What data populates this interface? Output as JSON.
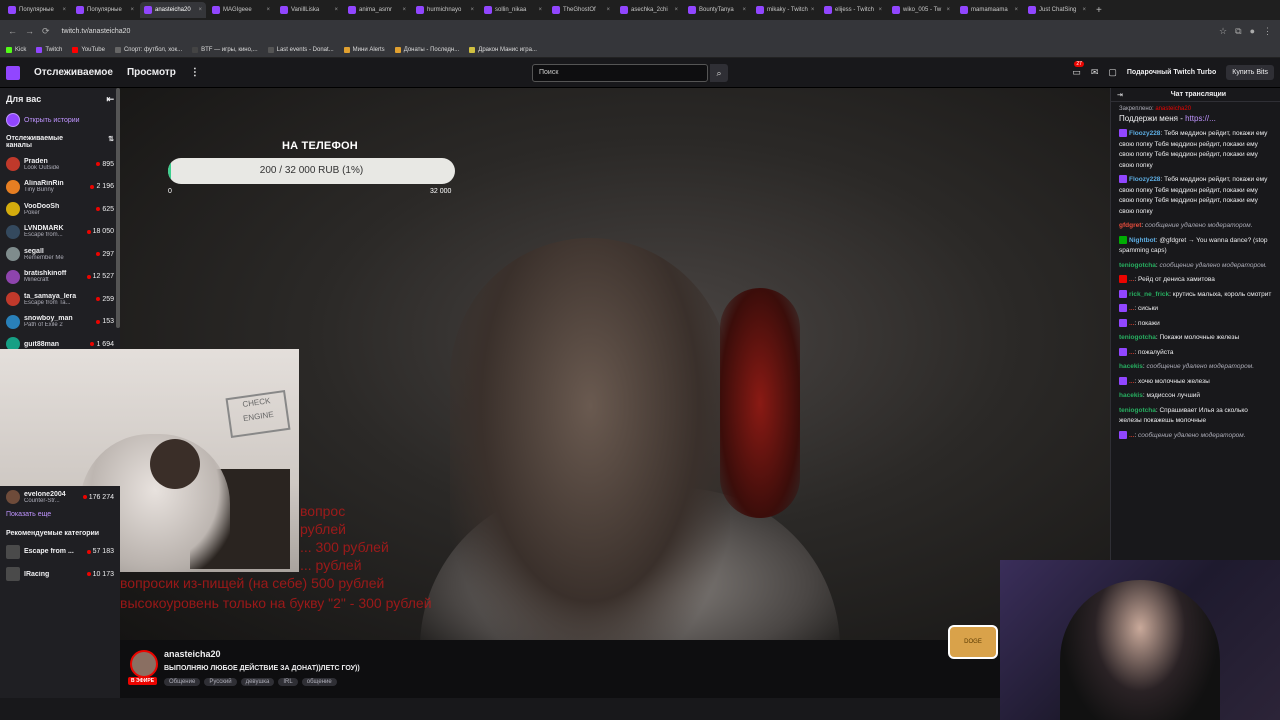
{
  "browser": {
    "tabs": [
      {
        "label": "Популярные",
        "active": false
      },
      {
        "label": "Популярные",
        "active": false
      },
      {
        "label": "anasteicha20",
        "active": true
      },
      {
        "label": "MAGIgeee",
        "active": false
      },
      {
        "label": "VanillLiska",
        "active": false
      },
      {
        "label": "anima_asmr",
        "active": false
      },
      {
        "label": "hurmichnayo",
        "active": false
      },
      {
        "label": "sollin_nikaa",
        "active": false
      },
      {
        "label": "TheGhostOf",
        "active": false
      },
      {
        "label": "asechka_2chi",
        "active": false
      },
      {
        "label": "BountyTanya",
        "active": false
      },
      {
        "label": "mikaky - Twitch",
        "active": false
      },
      {
        "label": "elijess - Twitch",
        "active": false
      },
      {
        "label": "wiko_005 - Tw",
        "active": false
      },
      {
        "label": "mamamaama",
        "active": false
      },
      {
        "label": "Just ChatSing",
        "active": false
      }
    ],
    "url": "twitch.tv/anasteicha20",
    "bookmarks": [
      {
        "label": "Kick",
        "color": "#53fc18"
      },
      {
        "label": "Twitch",
        "color": "#9146ff"
      },
      {
        "label": "YouTube",
        "color": "#ff0000"
      },
      {
        "label": "Спорт: футбол, хок...",
        "color": "#666666"
      },
      {
        "label": "BTF — игры, кино,...",
        "color": "#444444"
      },
      {
        "label": "Last events - Donat...",
        "color": "#555555"
      },
      {
        "label": "Мини Alerts",
        "color": "#e0a030"
      },
      {
        "label": "Донаты - Последн...",
        "color": "#e0a030"
      },
      {
        "label": "Дракон Манис игра...",
        "color": "#d0c040"
      }
    ]
  },
  "topnav": {
    "following": "Отслеживаемое",
    "browse": "Просмотр",
    "search_placeholder": "Поиск",
    "notif_count": "27",
    "turbo": "Подарочный Twitch Turbo",
    "bits": "Купить Bits"
  },
  "sidebar": {
    "title": "Для вас",
    "stories": "Открыть истории",
    "followed_title": "Отслеживаемые каналы",
    "channels": [
      {
        "name": "Praden",
        "game": "Look Outside",
        "viewers": "895",
        "color": "#c0392b"
      },
      {
        "name": "AlinaRinRin",
        "game": "Tiny Bunny",
        "viewers": "2 196",
        "color": "#e67e22"
      },
      {
        "name": "VooDooSh",
        "game": "Poker",
        "viewers": "625",
        "color": "#d4ac0d"
      },
      {
        "name": "LVNDMARK",
        "game": "Escape from...",
        "viewers": "18 050",
        "color": "#34495e"
      },
      {
        "name": "segall",
        "game": "Remember Me",
        "viewers": "297",
        "color": "#7f8c8d"
      },
      {
        "name": "bratishkinoff",
        "game": "Minecraft",
        "viewers": "12 527",
        "color": "#8e44ad"
      },
      {
        "name": "ta_samaya_lera",
        "game": "Escape from Ta...",
        "viewers": "259",
        "color": "#c0392b"
      },
      {
        "name": "snowboy_man",
        "game": "Path of Exile 2",
        "viewers": "153",
        "color": "#2980b9"
      },
      {
        "name": "guit88man",
        "game": "",
        "viewers": "1 694",
        "color": "#16a085"
      }
    ],
    "lower_channel": {
      "name": "evelone2004",
      "game": "Counter-Str...",
      "viewers": "176 274"
    },
    "show_more": "Показать еще",
    "recommended_title": "Рекомендуемые категории",
    "categories": [
      {
        "name": "Escape from ...",
        "viewers": "57 183"
      },
      {
        "name": "IRacing",
        "viewers": "10 173"
      }
    ]
  },
  "goal": {
    "title": "НА ТЕЛЕФОН",
    "label": "200 / 32 000 RUB (1%)",
    "progress": 0.01,
    "min": "0",
    "max": "32 000"
  },
  "overlay": {
    "lines": [
      {
        "text": "вопрос",
        "top": 0
      },
      {
        "text": "рублей",
        "top": 0
      },
      {
        "text": "... 300 рублей",
        "top": 0
      },
      {
        "text": "... рублей",
        "top": 0
      },
      {
        "text": "вопросик из-пищей (на себе) 500 рублей",
        "top": 0
      },
      {
        "text": "высокоуровень только на букву \"2\" - 300 рублей",
        "top": 0
      }
    ]
  },
  "cam": {
    "sign": "CHECK ENGINE"
  },
  "doge": "DOGE",
  "stream_info": {
    "channel": "anasteicha20",
    "title": "ВЫПОЛНЯЮ ЛЮБОЕ ДЕЙСТВИЕ ЗА ДОНАТ))ЛЕТС ГОУ))",
    "live_badge": "В ЭФИРЕ",
    "tags": [
      "Общение",
      "Русский",
      "девушка",
      "IRL",
      "общение"
    ]
  },
  "chat": {
    "title": "Чат трансляции",
    "pinned_label": "Закреплено:",
    "pinned_user": "anasteicha20",
    "pinned_text": "Поддержи меня - ",
    "pinned_link": "https://...",
    "messages": [
      {
        "user": "Floozy228",
        "ucolor": "#5dade2",
        "badge": "#9146ff",
        "text": "Тебя меддион рейдит, покажи ему свою попку Тебя меддион рейдит, покажи ему свою попку Тебя меддион рейдит, покажи ему свою попку",
        "deleted": false
      },
      {
        "user": "Floozy228",
        "ucolor": "#5dade2",
        "badge": "#9146ff",
        "text": "Тебя меддион рейдит, покажи ему свою попку Тебя меддион рейдит, покажи ему свою попку Тебя меддион рейдит, покажи ему свою попку",
        "deleted": false
      },
      {
        "user": "gfdgret",
        "ucolor": "#e74c3c",
        "badge": "",
        "text": "сообщение удалено модератором.",
        "deleted": true
      },
      {
        "user": "Nightbot",
        "ucolor": "#5dade2",
        "badge": "#00ad03",
        "text": "@gfdgret → You wanna dance? (stop spamming caps)",
        "deleted": false
      },
      {
        "user": "teniogotcha",
        "ucolor": "#27ae60",
        "badge": "",
        "text": "сообщение удалено модератором.",
        "deleted": true
      },
      {
        "user": "...",
        "ucolor": "#c0392b",
        "badge": "#eb0400",
        "text": "Рейд от дениса хамитова",
        "deleted": false
      },
      {
        "user": "rick_ne_frick",
        "ucolor": "#27ae60",
        "badge": "#9146ff",
        "text": "крутись малыха, король смотрит",
        "deleted": false
      },
      {
        "user": "...",
        "ucolor": "#c0392b",
        "badge": "#9146ff",
        "text": "сиськи",
        "deleted": false
      },
      {
        "user": "...",
        "ucolor": "#c0392b",
        "badge": "#9146ff",
        "text": "покажи",
        "deleted": false
      },
      {
        "user": "teniogotcha",
        "ucolor": "#27ae60",
        "badge": "",
        "text": "Покажи молочные железы",
        "deleted": false
      },
      {
        "user": "...",
        "ucolor": "#c0392b",
        "badge": "#9146ff",
        "text": "пожалуйста",
        "deleted": false
      },
      {
        "user": "hacekis",
        "ucolor": "#27ae60",
        "badge": "",
        "text": "сообщение удалено модератором.",
        "deleted": true
      },
      {
        "user": "...",
        "ucolor": "#c0392b",
        "badge": "#9146ff",
        "text": "хочю молочные железы",
        "deleted": false
      },
      {
        "user": "hacekis",
        "ucolor": "#27ae60",
        "badge": "",
        "text": "мэдиссон лучший",
        "deleted": false
      },
      {
        "user": "teniogotcha",
        "ucolor": "#27ae60",
        "badge": "",
        "text": "Спрашивает Илья за сколько железы покажешь молочные",
        "deleted": false
      },
      {
        "user": "...",
        "ucolor": "#c0392b",
        "badge": "#9146ff",
        "text": "сообщение удалено модератором.",
        "deleted": true
      }
    ]
  }
}
